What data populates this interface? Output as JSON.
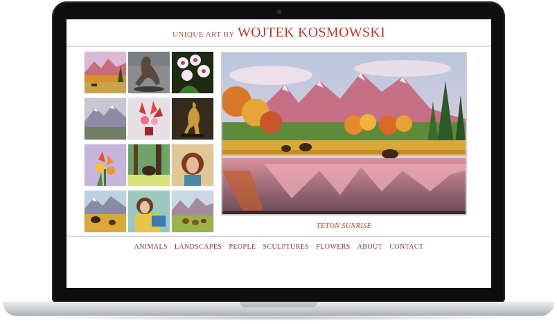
{
  "site": {
    "title_prefix": "UNIQUE ART BY",
    "title_name": "WOJTEK KOSMOWSKI",
    "accent_color": "#b03a2e"
  },
  "featured": {
    "caption": "TETON SUNRISE"
  },
  "nav": {
    "items": [
      "ANIMALS",
      "LANDSCAPES",
      "PEOPLE",
      "SCULPTURES",
      "FLOWERS",
      "ABOUT",
      "CONTACT"
    ]
  },
  "gallery": {
    "thumbnails": [
      "mountain-landscape-painting",
      "bronze-figure-sculpture",
      "orchid-flowers-painting",
      "snowy-mountains-painting",
      "red-flowers-vase-painting",
      "golden-figure-sculpture",
      "iris-flowers-painting",
      "forest-bear-painting",
      "woman-portrait-painting",
      "bison-prairie-painting",
      "woman-reading-painting",
      "bears-meadow-painting"
    ]
  }
}
